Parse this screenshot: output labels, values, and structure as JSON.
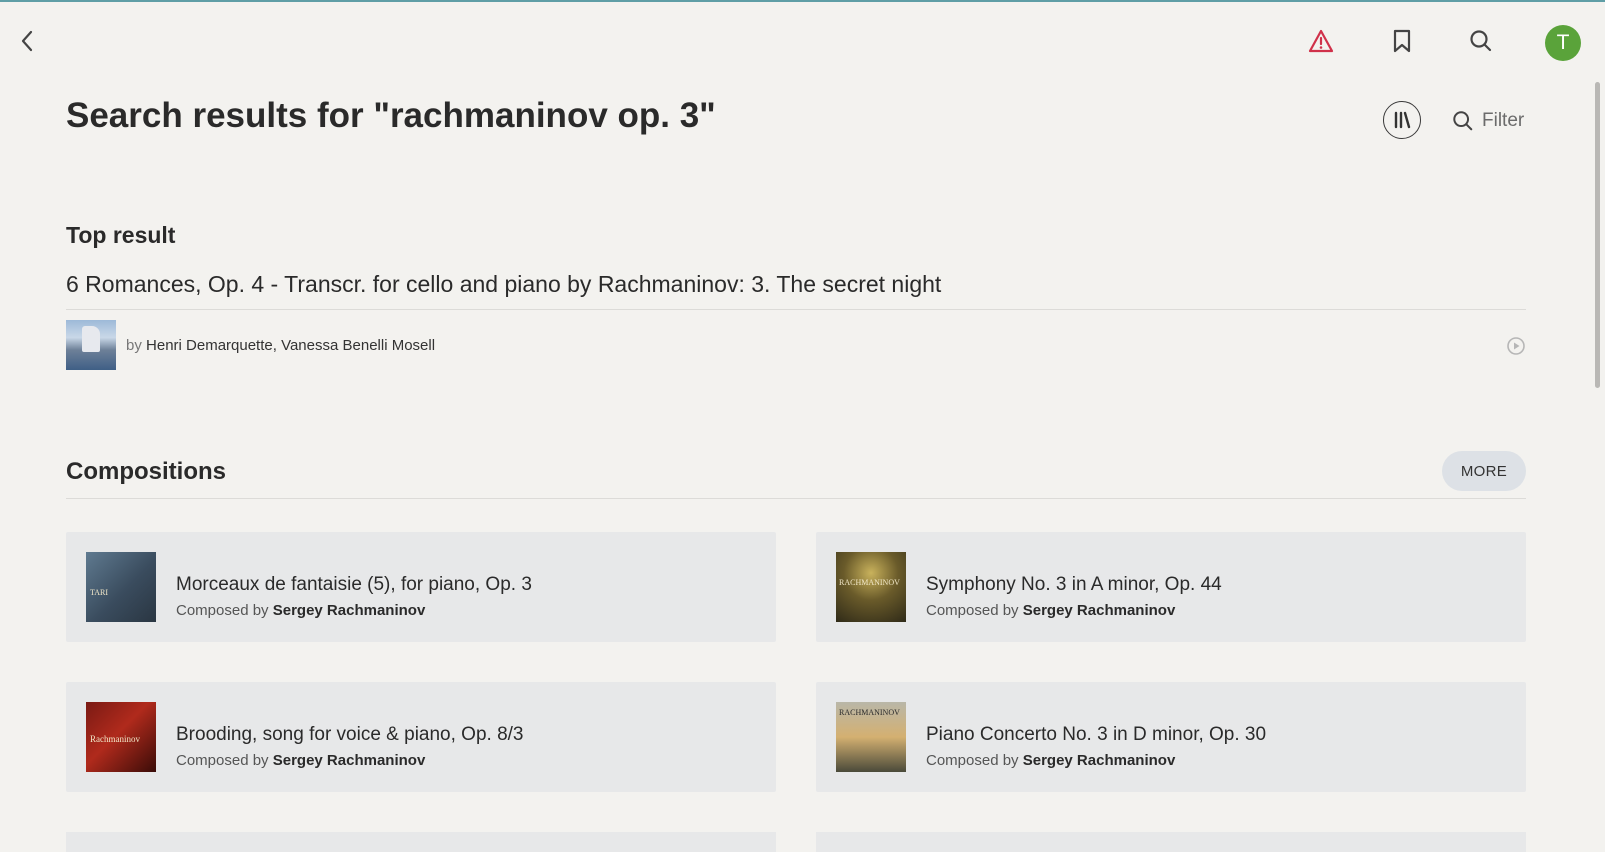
{
  "header": {
    "back_icon": "chevron-left-icon",
    "alert_icon": "alert-triangle-icon",
    "alert_color": "#d0314a",
    "bookmark_icon": "bookmark-icon",
    "search_icon": "search-icon",
    "avatar_initial": "T",
    "avatar_color": "#5aa33a"
  },
  "page": {
    "title": "Search results for \"rachmaninov op. 3\"",
    "library_icon": "library-icon",
    "filter_label": "Filter"
  },
  "top_result": {
    "heading": "Top result",
    "title": "6 Romances, Op. 4 - Transcr. for cello and piano by Rachmaninov: 3. The secret night",
    "by_label": "by",
    "artists": "Henri Demarquette, Vanessa Benelli Mosell",
    "play_icon": "play-circle-icon"
  },
  "compositions": {
    "heading": "Compositions",
    "more_label": "MORE",
    "composed_by_label": "Composed by",
    "items": [
      {
        "title": "Morceaux de fantaisie (5), for piano, Op. 3",
        "composer": "Sergey Rachmaninov"
      },
      {
        "title": "Symphony No. 3 in A minor, Op. 44",
        "composer": "Sergey Rachmaninov"
      },
      {
        "title": "Brooding, song for voice & piano, Op. 8/3",
        "composer": "Sergey Rachmaninov"
      },
      {
        "title": "Piano Concerto No. 3 in D minor, Op. 30",
        "composer": "Sergey Rachmaninov"
      }
    ]
  }
}
